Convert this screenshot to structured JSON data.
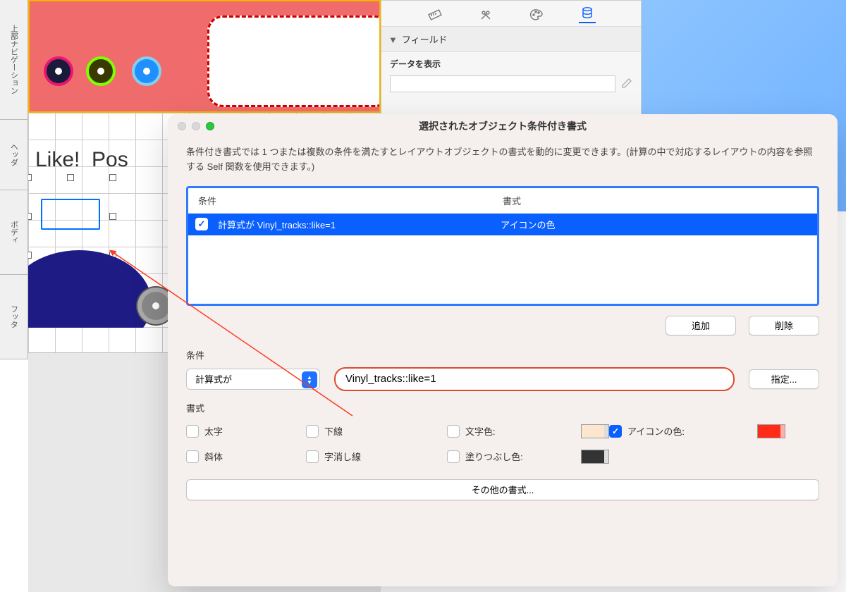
{
  "rail": {
    "s1": "上部ナビゲーション",
    "s2": "ヘッダ",
    "s3": "ボディ",
    "s4": "フッタ"
  },
  "canvas": {
    "like_label": "Like!",
    "pos_label": "Pos"
  },
  "inspector": {
    "field_section": "フィールド",
    "show_data": "データを表示"
  },
  "dialog": {
    "title": "選択されたオブジェクト条件付き書式",
    "description": "条件付き書式では 1 つまたは複数の条件を満たすとレイアウトオブジェクトの書式を動的に変更できます。(計算の中で対応するレイアウトの内容を参照する Self 関数を使用できます。)",
    "columns": {
      "condition": "条件",
      "format": "書式"
    },
    "row1": {
      "condition": "計算式が Vinyl_tracks::like=1",
      "format": "アイコンの色"
    },
    "buttons": {
      "add": "追加",
      "delete": "削除",
      "specify": "指定...",
      "other_format": "その他の書式..."
    },
    "condition_label": "条件",
    "condition_select": "計算式が",
    "expression": "Vinyl_tracks::like=1",
    "format_label": "書式",
    "checks": {
      "bold": "太字",
      "underline": "下線",
      "text_color": "文字色:",
      "icon_color": "アイコンの色:",
      "italic": "斜体",
      "strike": "字消し線",
      "fill_color": "塗りつぶし色:"
    }
  }
}
